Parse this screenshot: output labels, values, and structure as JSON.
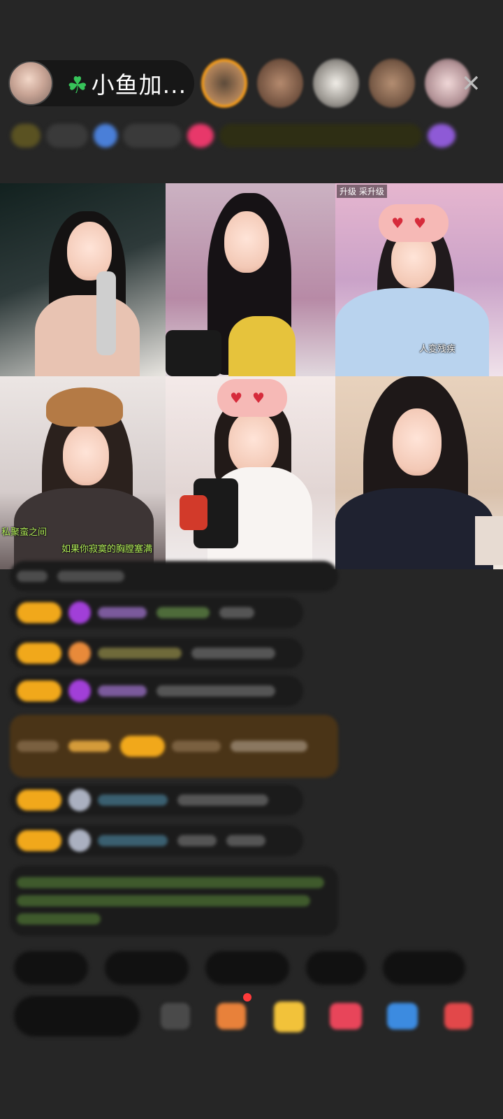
{
  "header": {
    "host_name": "小鱼加...",
    "close_label": "✕"
  },
  "grid": {
    "cell3_tags": [
      "升级",
      "采升级"
    ],
    "cell3_caption": "人变残疾",
    "cell4_caption_top": "私聚蛮之间",
    "cell4_caption_bottom": "如果你寂寞的胸膛塞满"
  },
  "icons": {
    "host_badge": "clover-icon",
    "close": "close-icon"
  },
  "colors": {
    "background": "#262626",
    "badge": "#f1a81b",
    "accent_gift": "#ff3b3b"
  }
}
